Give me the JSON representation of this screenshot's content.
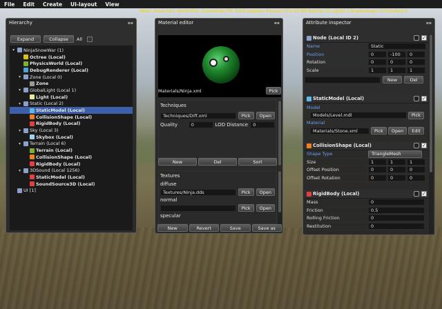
{
  "menu": [
    "File",
    "Edit",
    "Create",
    "UI-layout",
    "View"
  ],
  "status_line": "Mode: Move  Axis: World  Pick: Geometries  Fill: Solid  Updates: Paused  |  Tris 53789  Batches 51  Lights 1  Shadowmaps 0  Occluders 0",
  "hierarchy": {
    "title": "Hierarchy",
    "expand_label": "Expand",
    "collapse_label": "Collapse",
    "all_label": "All",
    "items": [
      {
        "label": "NinjaSnowWar (1)",
        "indent": 0,
        "expander": "▾",
        "bold": false,
        "selected": false,
        "icon_color": "#8aa0c8"
      },
      {
        "label": "Octree (Local)",
        "indent": 1,
        "expander": "",
        "bold": true,
        "selected": false,
        "icon_color": "#d8c020"
      },
      {
        "label": "PhysicsWorld (Local)",
        "indent": 1,
        "expander": "",
        "bold": true,
        "selected": false,
        "icon_color": "#7cb030"
      },
      {
        "label": "DebugRenderer (Local)",
        "indent": 1,
        "expander": "",
        "bold": true,
        "selected": false,
        "icon_color": "#50a0d8"
      },
      {
        "label": "Zone (Local 0)",
        "indent": 1,
        "expander": "▾",
        "bold": false,
        "selected": false,
        "icon_color": "#8aa0c8"
      },
      {
        "label": "Zone",
        "indent": 2,
        "expander": "",
        "bold": true,
        "selected": false,
        "icon_color": "#9a9a9a"
      },
      {
        "label": "GlobalLight (Local 1)",
        "indent": 1,
        "expander": "▾",
        "bold": false,
        "selected": false,
        "icon_color": "#8aa0c8"
      },
      {
        "label": "Light (Local)",
        "indent": 2,
        "expander": "",
        "bold": true,
        "selected": false,
        "icon_color": "#e8e8a0"
      },
      {
        "label": "Static (Local 2)",
        "indent": 1,
        "expander": "▾",
        "bold": false,
        "selected": false,
        "icon_color": "#8aa0c8"
      },
      {
        "label": "StaticModel (Local)",
        "indent": 2,
        "expander": "",
        "bold": true,
        "selected": true,
        "icon_color": "#60b8e8"
      },
      {
        "label": "CollisionShape (Local)",
        "indent": 2,
        "expander": "",
        "bold": true,
        "selected": false,
        "icon_color": "#f08020"
      },
      {
        "label": "RigidBody (Local)",
        "indent": 2,
        "expander": "",
        "bold": true,
        "selected": false,
        "icon_color": "#e04040"
      },
      {
        "label": "Sky (Local 3)",
        "indent": 1,
        "expander": "▾",
        "bold": false,
        "selected": false,
        "icon_color": "#8aa0c8"
      },
      {
        "label": "Skybox (Local)",
        "indent": 2,
        "expander": "",
        "bold": true,
        "selected": false,
        "icon_color": "#a0d0f0"
      },
      {
        "label": "Terrain (Local 6)",
        "indent": 1,
        "expander": "▾",
        "bold": false,
        "selected": false,
        "icon_color": "#8aa0c8"
      },
      {
        "label": "Terrain (Local)",
        "indent": 2,
        "expander": "",
        "bold": true,
        "selected": false,
        "icon_color": "#7cb030"
      },
      {
        "label": "CollisionShape (Local)",
        "indent": 2,
        "expander": "",
        "bold": true,
        "selected": false,
        "icon_color": "#f08020"
      },
      {
        "label": "RigidBody (Local)",
        "indent": 2,
        "expander": "",
        "bold": true,
        "selected": false,
        "icon_color": "#e04040"
      },
      {
        "label": "3DSound (Local 1256)",
        "indent": 1,
        "expander": "▾",
        "bold": false,
        "selected": false,
        "icon_color": "#8aa0c8"
      },
      {
        "label": "StaticModel (Local)",
        "indent": 2,
        "expander": "",
        "bold": true,
        "selected": false,
        "icon_color": "#e04040"
      },
      {
        "label": "SoundSource3D (Local)",
        "indent": 2,
        "expander": "",
        "bold": true,
        "selected": false,
        "icon_color": "#e04040"
      },
      {
        "label": "UI [1]",
        "indent": 0,
        "expander": "",
        "bold": false,
        "selected": false,
        "icon_color": "#8aa0c8"
      }
    ]
  },
  "material_editor": {
    "title": "Material editor",
    "material_path": "Materials/Ninja.xml",
    "pick_label": "Pick",
    "techniques_heading": "Techniques",
    "technique_path": "Techniques/Diff.xml",
    "technique_pick": "Pick",
    "technique_open": "Open",
    "quality_label": "Quality",
    "quality_value": "0",
    "lod_label": "LOD Distance",
    "lod_value": "0",
    "new_label": "New",
    "del_label": "Del",
    "sort_label": "Sort",
    "textures_heading": "Textures",
    "diffuse_label": "diffuse",
    "diffuse_path": "Textures/Ninja.dds",
    "normal_label": "normal",
    "normal_path": "",
    "specular_label": "specular",
    "tex_pick": "Pick",
    "tex_open": "Open",
    "footer": [
      "New",
      "Revert",
      "Save",
      "Save as"
    ]
  },
  "attribute_inspector": {
    "title": "Attribute inspector",
    "node": {
      "header": "Node (Local ID 2)",
      "name_label": "Name",
      "name_value": "Static",
      "position_label": "Position",
      "position": [
        "0",
        "-100",
        "0"
      ],
      "rotation_label": "Rotation",
      "rotation": [
        "0",
        "0",
        "0"
      ],
      "scale_label": "Scale",
      "scale": [
        "1",
        "1",
        "1"
      ],
      "new_label": "New",
      "del_label": "Del"
    },
    "static_model": {
      "header": "StaticModel (Local)",
      "model_label": "Model",
      "model_value": "Models/Level.mdl",
      "material_label": "Material",
      "material_value": "Materials/Stone.xml",
      "pick": "Pick",
      "open": "Open",
      "edit": "Edit"
    },
    "collision_shape": {
      "header": "CollisionShape (Local)",
      "shape_type_label": "Shape Type",
      "shape_type_value": "TriangleMesh",
      "size_label": "Size",
      "size": [
        "1",
        "1",
        "1"
      ],
      "offset_pos_label": "Offset Position",
      "offset_pos": [
        "0",
        "0",
        "0"
      ],
      "offset_rot_label": "Offset Rotation",
      "offset_rot": [
        "0",
        "0",
        "0"
      ]
    },
    "rigid_body": {
      "header": "RigidBody (Local)",
      "mass_label": "Mass",
      "mass_value": "0",
      "friction_label": "Friction",
      "friction_value": "0.5",
      "rolling_label": "Rolling Friction",
      "rolling_value": "0",
      "restitution_label": "Restitution",
      "restitution_value": "0"
    }
  },
  "colors": {
    "selection": "#3c5fa8",
    "status_text": "#f0d400",
    "link_label": "#6ea0f0"
  }
}
